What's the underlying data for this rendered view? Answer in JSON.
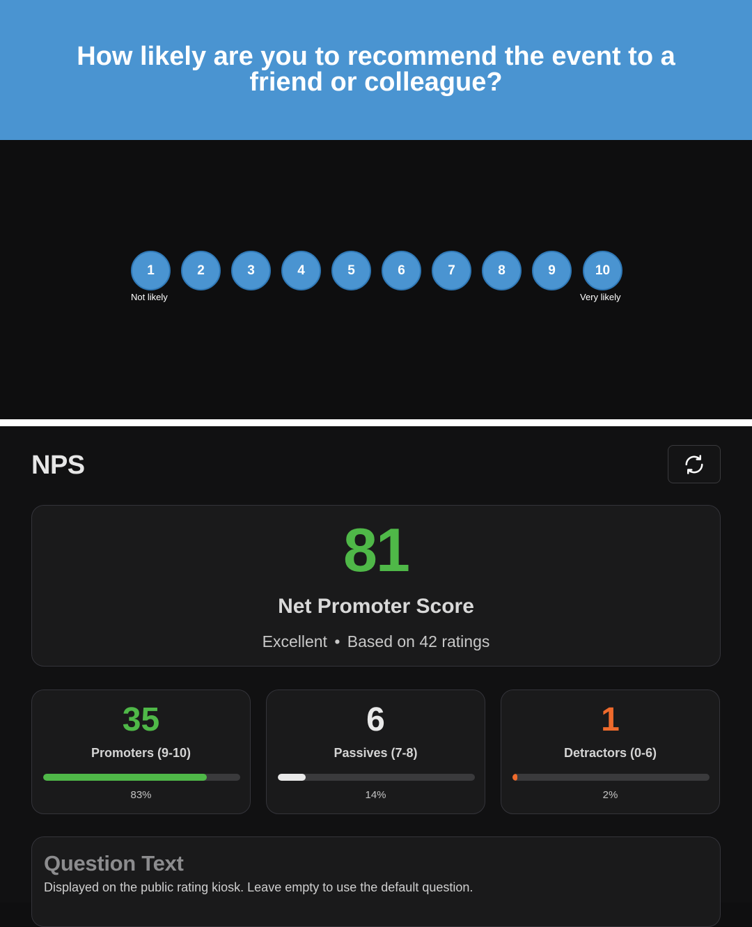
{
  "kiosk": {
    "question": "How likely are you to recommend the event to a friend or colleague?",
    "scale": [
      "1",
      "2",
      "3",
      "4",
      "5",
      "6",
      "7",
      "8",
      "9",
      "10"
    ],
    "low_label": "Not likely",
    "high_label": "Very likely",
    "colors": {
      "header_bg": "#4a94d1",
      "button_bg": "#4a94d1"
    }
  },
  "admin": {
    "title": "NPS",
    "refresh_icon": "refresh-icon",
    "score": {
      "value": "81",
      "label": "Net Promoter Score",
      "rating": "Excellent",
      "separator": "•",
      "based_on": "Based on 42 ratings",
      "color": "#4fb848"
    },
    "stats": [
      {
        "value": "35",
        "label": "Promoters (9-10)",
        "percent_text": "83%",
        "fraction": 0.83,
        "color": "#4fb848"
      },
      {
        "value": "6",
        "label": "Passives (7-8)",
        "percent_text": "14%",
        "fraction": 0.14,
        "color": "#e9e9e9"
      },
      {
        "value": "1",
        "label": "Detractors (0-6)",
        "percent_text": "2%",
        "fraction": 0.02,
        "color": "#ee6a2c"
      }
    ],
    "question_text": {
      "title": "Question Text",
      "description": "Displayed on the public rating kiosk. Leave empty to use the default question."
    }
  }
}
